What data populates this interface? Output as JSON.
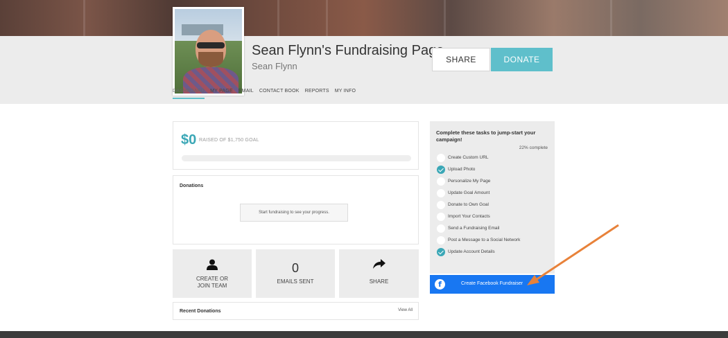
{
  "profile": {
    "title": "Sean Flynn's Fundraising Page",
    "name": "Sean Flynn"
  },
  "header_actions": {
    "share_label": "SHARE",
    "donate_label": "DONATE"
  },
  "nav": {
    "tabs": [
      {
        "label": "DASHBOARD",
        "active": true
      },
      {
        "label": "MY PAGE",
        "active": false
      },
      {
        "label": "EMAIL",
        "active": false
      },
      {
        "label": "CONTACT BOOK",
        "active": false
      },
      {
        "label": "REPORTS",
        "active": false
      },
      {
        "label": "MY INFO",
        "active": false
      }
    ]
  },
  "fundraising": {
    "raised_amount": "$0",
    "raised_text": "RAISED OF $1,750 GOAL",
    "progress_fraction": 0
  },
  "donations": {
    "title": "Donations",
    "empty_message": "Start fundraising to see your progress."
  },
  "tiles": {
    "team_label_line1": "CREATE OR",
    "team_label_line2": "JOIN TEAM",
    "emails_count": "0",
    "emails_label": "EMAILS SENT",
    "share_label": "SHARE"
  },
  "recent_donations": {
    "title": "Recent Donations",
    "view_all": "View All"
  },
  "tasks": {
    "title": "Complete these tasks to jump-start your campaign!",
    "percent_complete": "22% complete",
    "items": [
      {
        "label": "Create Custom URL",
        "done": false
      },
      {
        "label": "Upload Photo",
        "done": true
      },
      {
        "label": "Personalize My Page",
        "done": false
      },
      {
        "label": "Update Goal Amount",
        "done": false
      },
      {
        "label": "Donate to Own Goal",
        "done": false
      },
      {
        "label": "Import Your Contacts",
        "done": false
      },
      {
        "label": "Send a Fundraising Email",
        "done": false
      },
      {
        "label": "Post a Message to a Social Network",
        "done": false
      },
      {
        "label": "Update Account Details",
        "done": true
      }
    ]
  },
  "facebook": {
    "button_label": "Create Facebook Fundraiser",
    "icon": "facebook-icon"
  },
  "colors": {
    "accent": "#5fbfcb",
    "raised": "#3aa7b6",
    "facebook": "#1877f2",
    "annotation_arrow": "#e8823a"
  }
}
